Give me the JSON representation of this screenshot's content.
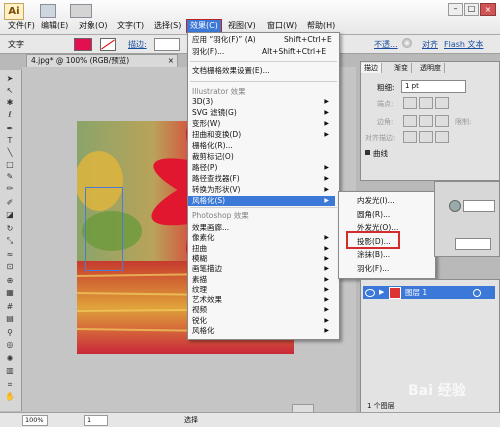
{
  "app": {
    "logo": "Ai"
  },
  "menubar": {
    "items": [
      {
        "label": "文件(F)",
        "active": false
      },
      {
        "label": "编辑(E)",
        "active": false
      },
      {
        "label": "对象(O)",
        "active": false
      },
      {
        "label": "文字(T)",
        "active": false
      },
      {
        "label": "选择(S)",
        "active": false
      },
      {
        "label": "效果(C)",
        "active": true
      },
      {
        "label": "视图(V)",
        "active": false
      },
      {
        "label": "窗口(W)",
        "active": false
      },
      {
        "label": "帮助(H)",
        "active": false
      }
    ]
  },
  "control_bar": {
    "label": "文字",
    "stroke_label": "描边:",
    "opacity_label": "不透...",
    "align_label": "对齐",
    "flash_label": "Flash 文本",
    "fill_color": "#e3104f"
  },
  "document_tab": {
    "title": "4.jpg* @ 100% (RGB/预览)"
  },
  "effect_menu": {
    "apply_label": "应用 “羽化(F)” (A)",
    "apply_shortcut": "Shift+Ctrl+E",
    "last_label": "羽化(F)...",
    "last_shortcut": "Alt+Shift+Ctrl+E",
    "settings_label": "文档栅格效果设置(E)...",
    "illustrator_header": "Illustrator 效果",
    "illustrator_items": [
      {
        "label": "3D(3)",
        "arrow": true
      },
      {
        "label": "SVG 滤镜(G)",
        "arrow": true
      },
      {
        "label": "变形(W)",
        "arrow": true
      },
      {
        "label": "扭曲和变换(D)",
        "arrow": true
      },
      {
        "label": "栅格化(R)...",
        "arrow": false
      },
      {
        "label": "裁剪标记(O)",
        "arrow": false
      },
      {
        "label": "路径(P)",
        "arrow": true
      },
      {
        "label": "路径查找器(F)",
        "arrow": true
      },
      {
        "label": "转换为形状(V)",
        "arrow": true
      },
      {
        "label": "风格化(S)",
        "arrow": true,
        "selected": true
      }
    ],
    "photoshop_header": "Photoshop 效果",
    "photoshop_items": [
      {
        "label": "效果画廊...",
        "arrow": false
      },
      {
        "label": "像素化",
        "arrow": true
      },
      {
        "label": "扭曲",
        "arrow": true
      },
      {
        "label": "模糊",
        "arrow": true
      },
      {
        "label": "画笔描边",
        "arrow": true
      },
      {
        "label": "素描",
        "arrow": true
      },
      {
        "label": "纹理",
        "arrow": true
      },
      {
        "label": "艺术效果",
        "arrow": true
      },
      {
        "label": "视频",
        "arrow": true
      },
      {
        "label": "锐化",
        "arrow": true
      },
      {
        "label": "风格化",
        "arrow": true
      }
    ]
  },
  "stylize_submenu": {
    "items": [
      {
        "label": "内发光(I)...",
        "highlighted": false
      },
      {
        "label": "圆角(R)...",
        "highlighted": false
      },
      {
        "label": "外发光(O)...",
        "highlighted": false
      },
      {
        "label": "投影(D)...",
        "highlighted": true
      },
      {
        "label": "涂抹(B)...",
        "highlighted": false
      },
      {
        "label": "羽化(F)...",
        "highlighted": false
      }
    ]
  },
  "stroke_panel": {
    "tabs": [
      "描边",
      "渐变",
      "透明度"
    ],
    "weight_label": "粗细:",
    "weight_value": "1 pt",
    "cap_label": "端点:",
    "corner_label": "边角:",
    "limit_label": "限制:",
    "align_label": "对齐描边:",
    "section_label": "曲线"
  },
  "layers_panel": {
    "layer_name": "图层 1",
    "count": "1 个图层"
  },
  "status_bar": {
    "zoom": "100%",
    "page": "1",
    "tool": "选择"
  },
  "watermark": "Bai 经验"
}
